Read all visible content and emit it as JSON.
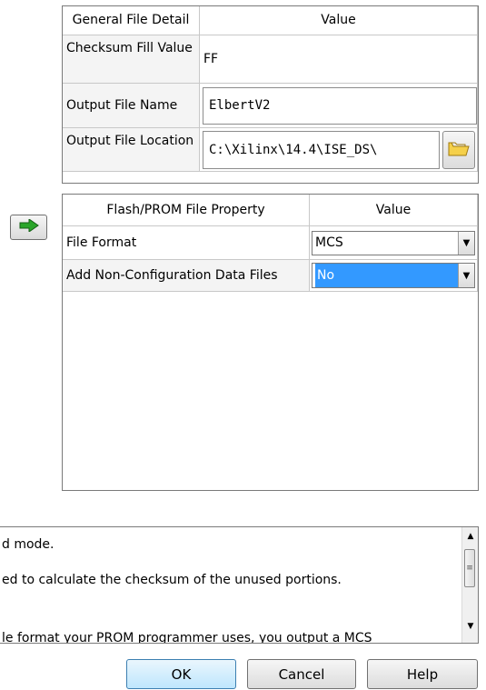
{
  "general_table": {
    "header_property": "General File Detail",
    "header_value": "Value",
    "rows": [
      {
        "label": "Checksum Fill Value",
        "value": "FF"
      },
      {
        "label": "Output File Name",
        "value": "ElbertV2"
      },
      {
        "label": "Output File Location",
        "value": "C:\\Xilinx\\14.4\\ISE_DS\\"
      }
    ]
  },
  "flash_table": {
    "header_property": "Flash/PROM File Property",
    "header_value": "Value",
    "rows": [
      {
        "label": "File Format",
        "value": "MCS"
      },
      {
        "label": "Add Non-Configuration Data Files",
        "value": "No"
      }
    ]
  },
  "description": {
    "lines": [
      "d mode.",
      "ed to calculate the checksum of the unused portions.",
      "le format your PROM programmer uses, you output a MCS"
    ]
  },
  "buttons": {
    "ok": "OK",
    "cancel": "Cancel",
    "help": "Help"
  },
  "icons": {
    "arrow": "arrow-right-icon",
    "folder": "folder-icon"
  },
  "colors": {
    "selection": "#3399ff",
    "arrow_green": "#2aa52a",
    "folder_yellow": "#f5d04a"
  }
}
